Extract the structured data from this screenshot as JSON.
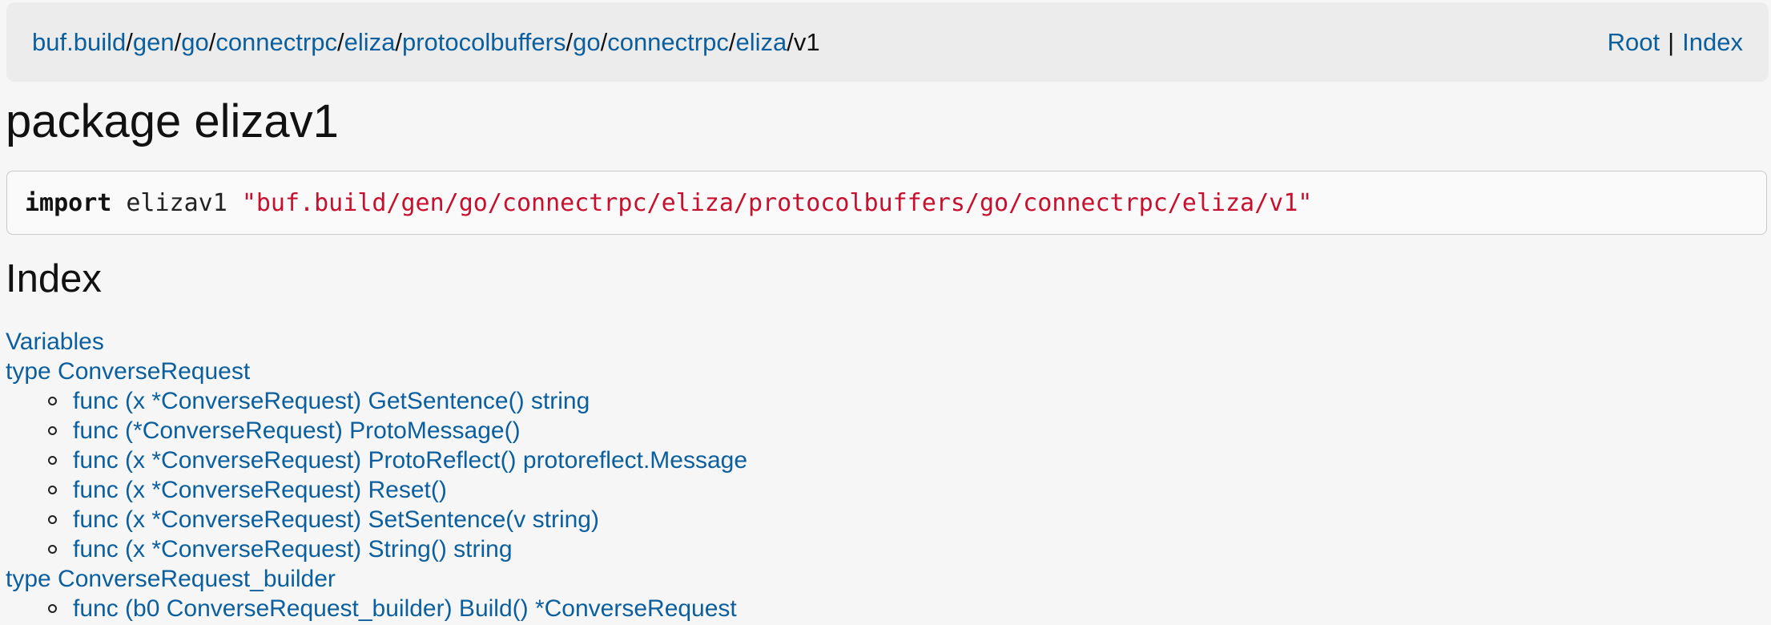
{
  "header": {
    "breadcrumbs": [
      {
        "label": "buf.build"
      },
      {
        "label": "gen"
      },
      {
        "label": "go"
      },
      {
        "label": "connectrpc"
      },
      {
        "label": "eliza"
      },
      {
        "label": "protocolbuffers"
      },
      {
        "label": "go"
      },
      {
        "label": "connectrpc"
      },
      {
        "label": "eliza"
      }
    ],
    "separator": "/",
    "current": "v1",
    "nav": {
      "root": "Root",
      "divider": "|",
      "index": "Index"
    }
  },
  "package": {
    "title": "package elizav1"
  },
  "import_stmt": {
    "keyword": "import",
    "name": "elizav1",
    "path": "\"buf.build/gen/go/connectrpc/eliza/protocolbuffers/go/connectrpc/eliza/v1\""
  },
  "index": {
    "title": "Index",
    "variables": "Variables",
    "types": [
      {
        "label": "type ConverseRequest",
        "methods": [
          "func (x *ConverseRequest) GetSentence() string",
          "func (*ConverseRequest) ProtoMessage()",
          "func (x *ConverseRequest) ProtoReflect() protoreflect.Message",
          "func (x *ConverseRequest) Reset()",
          "func (x *ConverseRequest) SetSentence(v string)",
          "func (x *ConverseRequest) String() string"
        ]
      },
      {
        "label": "type ConverseRequest_builder",
        "methods": [
          "func (b0 ConverseRequest_builder) Build() *ConverseRequest"
        ]
      }
    ]
  },
  "colors": {
    "link": "#0b5f9e",
    "string_literal": "#c8102e",
    "header_bg": "#ececec",
    "page_bg": "#f6f6f6"
  }
}
